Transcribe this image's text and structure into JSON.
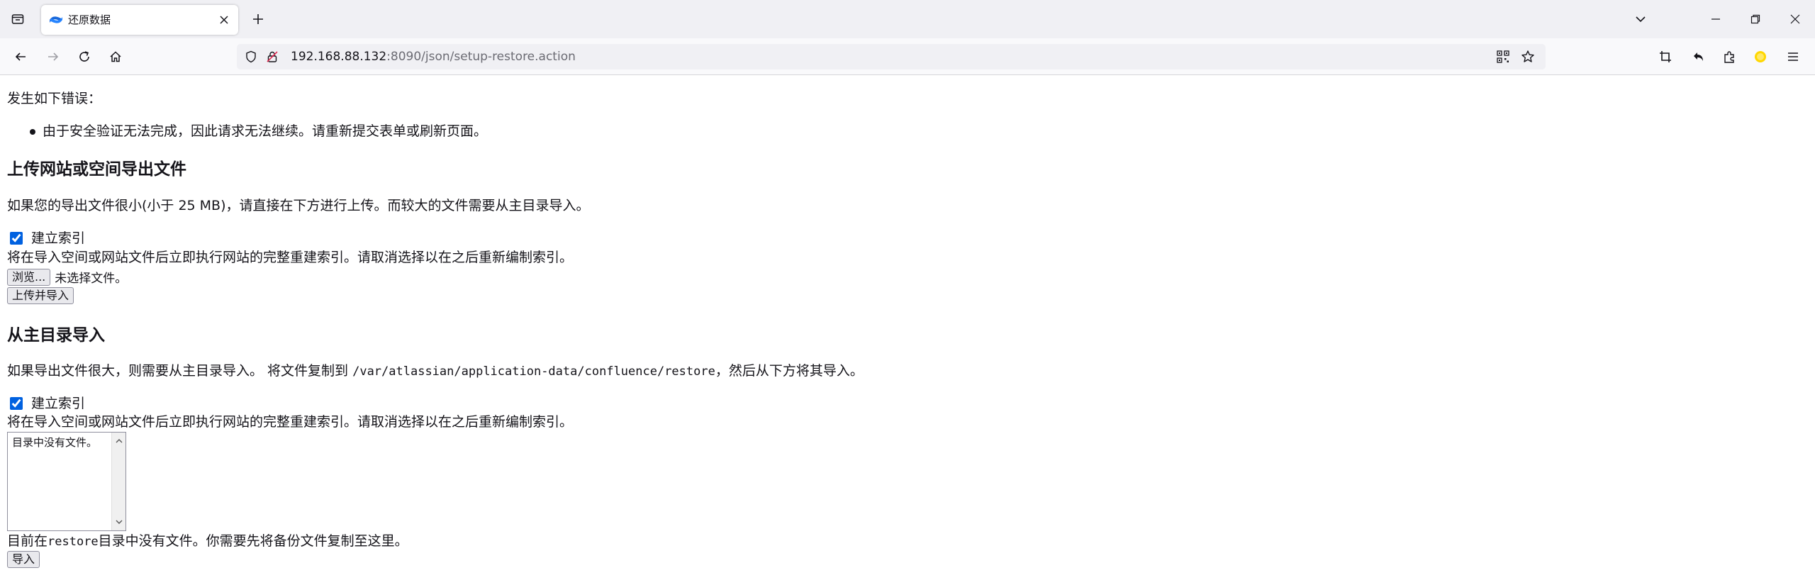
{
  "browser": {
    "tab": {
      "title": "还原数据"
    },
    "url": {
      "host": "192.168.88.132",
      "rest": ":8090/json/setup-restore.action"
    },
    "accent": "#0061e0",
    "favicon_color": "#1868db"
  },
  "page": {
    "error": {
      "title": "发生如下错误：",
      "items": [
        "由于安全验证无法完成，因此请求无法继续。请重新提交表单或刷新页面。"
      ]
    },
    "upload_section": {
      "heading": "上传网站或空间导出文件",
      "description": "如果您的导出文件很小(小于 25 MB)，请直接在下方进行上传。而较大的文件需要从主目录导入。",
      "index_checkbox_label": "建立索引",
      "index_checked": true,
      "index_note": "将在导入空间或网站文件后立即执行网站的完整重建索引。请取消选择以在之后重新编制索引。",
      "browse_button": "浏览...",
      "file_status": "未选择文件。",
      "submit_button": "上传并导入"
    },
    "home_section": {
      "heading": "从主目录导入",
      "description_before": "如果导出文件很大，则需要从主目录导入。 将文件复制到 ",
      "restore_path": "/var/atlassian/application-data/confluence/restore",
      "description_after": "，然后从下方将其导入。",
      "index_checkbox_label": "建立索引",
      "index_checked": true,
      "index_note": "将在导入空间或网站文件后立即执行网站的完整重建索引。请取消选择以在之后重新编制索引。",
      "file_list_empty": "目录中没有文件。",
      "empty_before": "目前在",
      "empty_dir": "restore",
      "empty_after": "目录中没有文件。你需要先将备份文件复制至这里。",
      "submit_button": "导入"
    }
  }
}
